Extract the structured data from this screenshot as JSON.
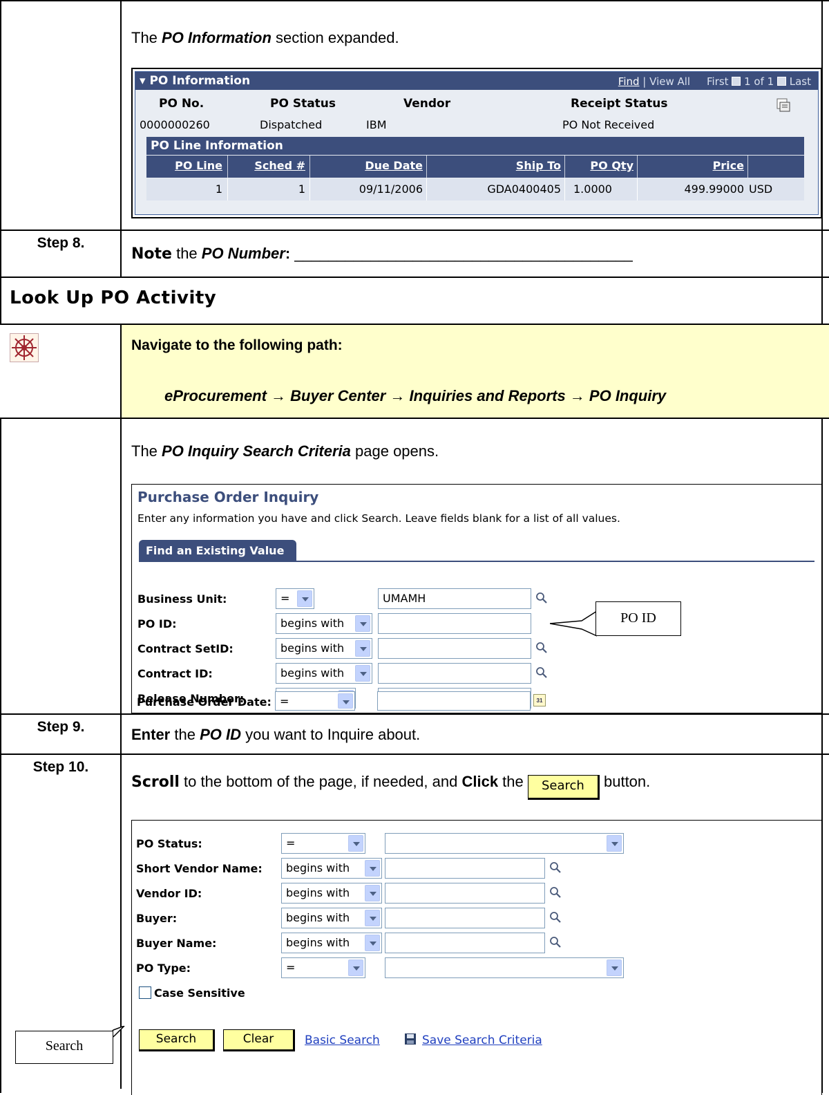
{
  "section1": {
    "caption_pre": "The ",
    "caption_em": "PO Information",
    "caption_post": " section expanded.",
    "grid": {
      "title": "PO Information",
      "nav_find": "Find",
      "nav_sep": "|",
      "nav_viewall": "View All",
      "nav_first": "First",
      "nav_count": "1 of 1",
      "nav_last": "Last",
      "headers": {
        "po_no": "PO No.",
        "po_status": "PO Status",
        "vendor": "Vendor",
        "receipt_status": "Receipt Status"
      },
      "values": {
        "po_no": "0000000260",
        "po_status": "Dispatched",
        "vendor": "IBM",
        "receipt_status": "PO Not Received"
      },
      "line_title": "PO Line Information",
      "columns": [
        "PO Line",
        "Sched #",
        "Due Date",
        "Ship To",
        "PO Qty",
        "Price"
      ],
      "rows": [
        [
          "1",
          "1",
          "09/11/2006",
          "GDA0400405",
          "1.0000",
          "499.99000",
          "USD"
        ]
      ]
    }
  },
  "step8": {
    "label": "Step 8.",
    "action": "Note",
    "text_mid": " the ",
    "field": "PO Number",
    "colon": ":",
    "blank": "________________________________________"
  },
  "section2": {
    "title": "Look Up PO Activity",
    "nav_heading": "Navigate to the following path:",
    "path": "eProcurement → Buyer Center → Inquiries and Reports → PO Inquiry"
  },
  "section3": {
    "caption_pre": "The ",
    "caption_em": "PO Inquiry Search Criteria",
    "caption_post": " page opens.",
    "page_title": "Purchase Order Inquiry",
    "instructions": "Enter any information you have and click Search. Leave fields blank for a list of all values.",
    "tab": "Find an Existing Value",
    "fields": [
      {
        "label": "Business Unit:",
        "op": "=",
        "value": "UMAMH"
      },
      {
        "label": "PO ID:",
        "op": "begins with",
        "value": ""
      },
      {
        "label": "Contract SetID:",
        "op": "begins with",
        "value": ""
      },
      {
        "label": "Contract ID:",
        "op": "begins with",
        "value": ""
      },
      {
        "label": "Release Number:",
        "op": "=",
        "value": ""
      },
      {
        "label": "Purchase Order Date:",
        "op": "=",
        "value": ""
      }
    ],
    "callout": "PO ID"
  },
  "step9": {
    "label": "Step 9.",
    "action": "Enter",
    "text_mid": " the ",
    "field": "PO ID",
    "text_post": " you want to Inquire about."
  },
  "step10": {
    "label": "Step 10.",
    "action1": "Scroll",
    "text1": " to the bottom of the page, if needed, and ",
    "action2": "Click",
    "text2": " the ",
    "button": "Search",
    "text3": " button.",
    "fields": [
      {
        "label": "PO Status:",
        "op": "=",
        "value": ""
      },
      {
        "label": "Short Vendor Name:",
        "op": "begins with",
        "value": ""
      },
      {
        "label": "Vendor ID:",
        "op": "begins with",
        "value": ""
      },
      {
        "label": "Buyer:",
        "op": "begins with",
        "value": ""
      },
      {
        "label": "Buyer Name:",
        "op": "begins with",
        "value": ""
      },
      {
        "label": "PO Type:",
        "op": "=",
        "value": ""
      }
    ],
    "case_sensitive": "Case Sensitive",
    "btn_search": "Search",
    "btn_clear": "Clear",
    "link_basic": "Basic Search",
    "link_save": "Save Search Criteria",
    "callout": "Search"
  },
  "colors": {
    "accent": "#3c4e7c",
    "highlight": "#ffffcc",
    "button": "#ffffa0",
    "link": "#1f3fbf"
  }
}
